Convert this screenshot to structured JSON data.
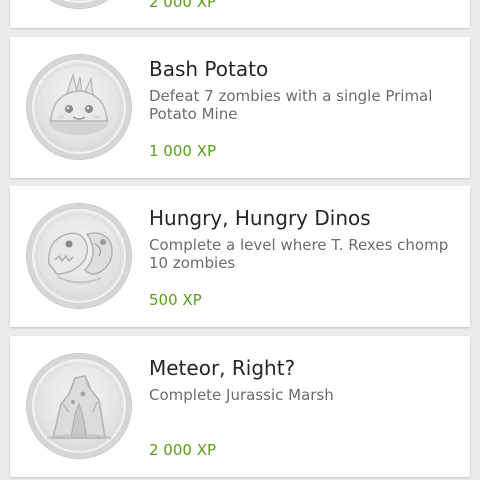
{
  "achievements": [
    {
      "title": "",
      "description": "",
      "xp": "2 000 XP",
      "icon": "achievement-badge-icon"
    },
    {
      "title": "Bash Potato",
      "description": "Defeat 7 zombies with a single Primal Potato Mine",
      "xp": "1 000 XP",
      "icon": "primal-potato-mine-badge-icon"
    },
    {
      "title": "Hungry, Hungry Dinos",
      "description": "Complete a level where T. Rexes chomp 10 zombies",
      "xp": "500 XP",
      "icon": "t-rex-badge-icon"
    },
    {
      "title": "Meteor, Right?",
      "description": "Complete Jurassic Marsh",
      "xp": "2 000 XP",
      "icon": "meteor-badge-icon"
    }
  ],
  "colors": {
    "background": "#ececec",
    "card": "#ffffff",
    "title": "#262626",
    "description": "#6c6c6c",
    "xp": "#5c9d1c"
  }
}
